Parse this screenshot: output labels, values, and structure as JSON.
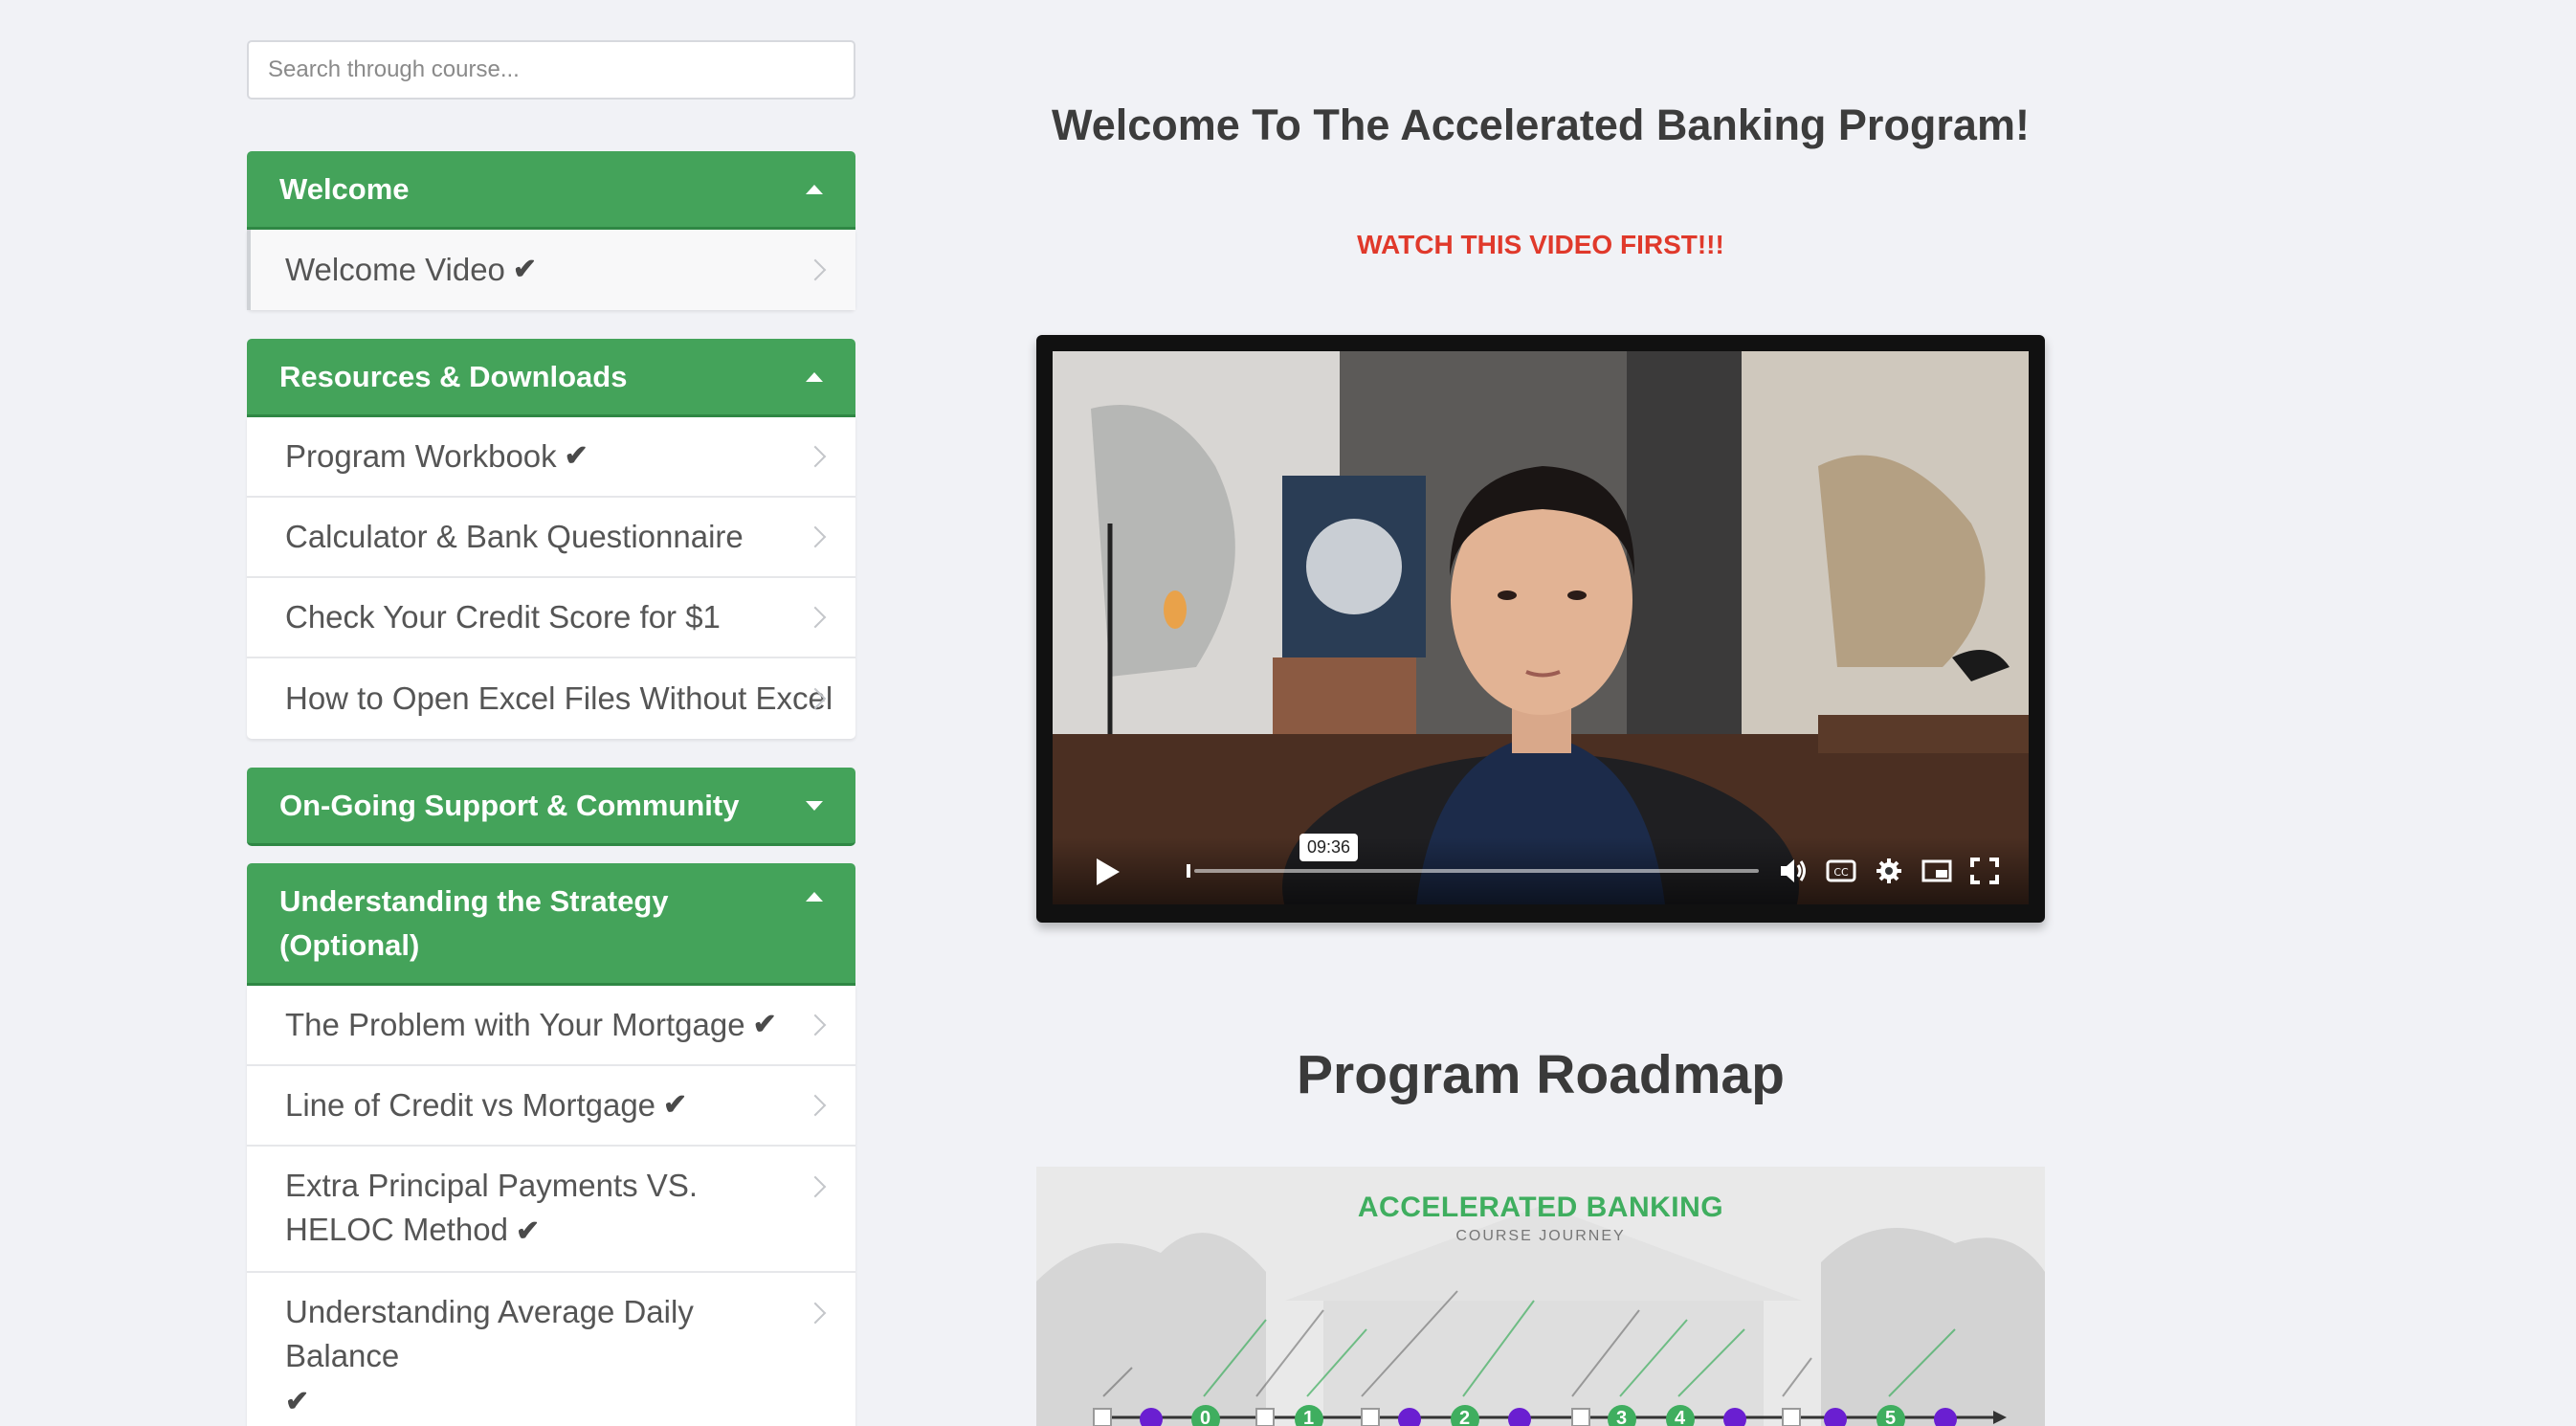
{
  "search": {
    "placeholder": "Search through course..."
  },
  "sidebar": {
    "sections": [
      {
        "title": "Welcome",
        "items": [
          {
            "label": "Welcome Video",
            "complete": true
          }
        ]
      },
      {
        "title": "Resources & Downloads",
        "items": [
          {
            "label": "Program Workbook",
            "complete": true
          },
          {
            "label": "Calculator & Bank Questionnaire",
            "complete": false
          },
          {
            "label": "Check Your Credit Score for $1",
            "complete": false
          },
          {
            "label": "How to Open Excel Files Without Excel",
            "complete": false
          }
        ]
      },
      {
        "title": "On-Going Support & Community",
        "items": []
      },
      {
        "title": "Understanding the Strategy (Optional)",
        "items": [
          {
            "label": "The Problem with Your Mortgage",
            "complete": true
          },
          {
            "label": "Line of Credit vs Mortgage",
            "complete": true
          },
          {
            "label": "Extra Principal Payments VS. HELOC Method",
            "complete": true
          },
          {
            "label": "Understanding Average Daily Balance",
            "complete": true
          }
        ]
      }
    ]
  },
  "main": {
    "title": "Welcome To The Accelerated Banking Program!",
    "watch_note": "WATCH THIS VIDEO FIRST!!!",
    "video": {
      "duration_tooltip": "09:36",
      "progress": 0.0
    },
    "roadmap_heading": "Program Roadmap",
    "roadmap_image": {
      "title": "ACCELERATED BANKING",
      "subtitle": "COURSE JOURNEY",
      "step_numbers": [
        "0",
        "1",
        "2",
        "3",
        "4",
        "5"
      ]
    }
  },
  "colors": {
    "accent": "#44a35a",
    "warning": "#e0392b",
    "roadmap_purple": "#6a1fd1"
  }
}
